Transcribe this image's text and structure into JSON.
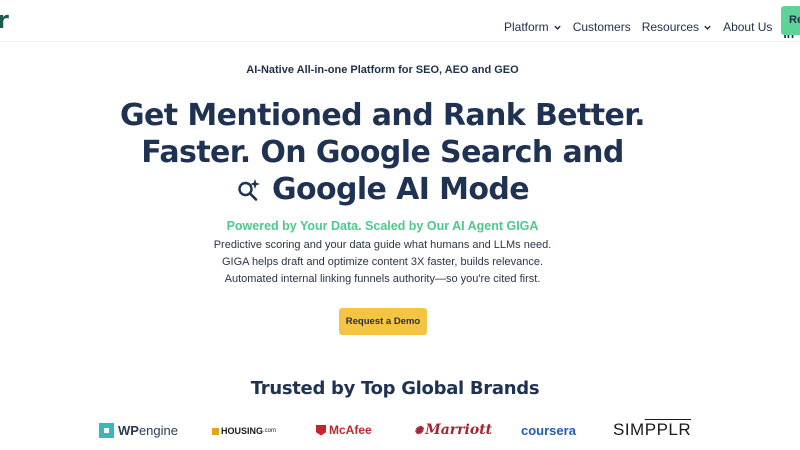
{
  "header": {
    "logo": "r",
    "nav": [
      {
        "label": "Platform",
        "dropdown": true
      },
      {
        "label": "Customers",
        "dropdown": false
      },
      {
        "label": "Resources",
        "dropdown": true
      },
      {
        "label": "About Us",
        "dropdown": false
      }
    ],
    "signin": "Sign In",
    "cta": "Re"
  },
  "hero": {
    "eyebrow": "AI-Native All-in-one Platform for SEO, AEO and GEO",
    "headline_line1": "Get Mentioned and Rank Better.",
    "headline_line2": "Faster. On Google Search and",
    "headline_line3": "Google AI Mode",
    "subhead": "Powered by Your Data. Scaled by Our AI Agent GIGA",
    "description": "Predictive scoring and your data guide what humans and LLMs need. GIGA helps draft and optimize content 3X faster, builds relevance. Automated internal linking funnels authority—so you're cited first.",
    "demo_button": "Request a Demo"
  },
  "brands": {
    "title": "Trusted by Top Global Brands",
    "wpengine_a": "WP",
    "wpengine_b": "engine",
    "housing": "HOUSING",
    "housing_sub": ".com",
    "mcafee": "McAfee",
    "marriott": "Marriott",
    "coursera": "coursera",
    "simpplr_a": "SIM",
    "simpplr_b": "PPLR"
  },
  "icons": {
    "ai_mode": "sparkle-search-icon",
    "dropdown": "chevron-down-icon"
  },
  "colors": {
    "navy": "#1f3252",
    "green": "#4ec98b",
    "cta_green": "#5dd39a",
    "demo_yellow": "#f5c443"
  }
}
